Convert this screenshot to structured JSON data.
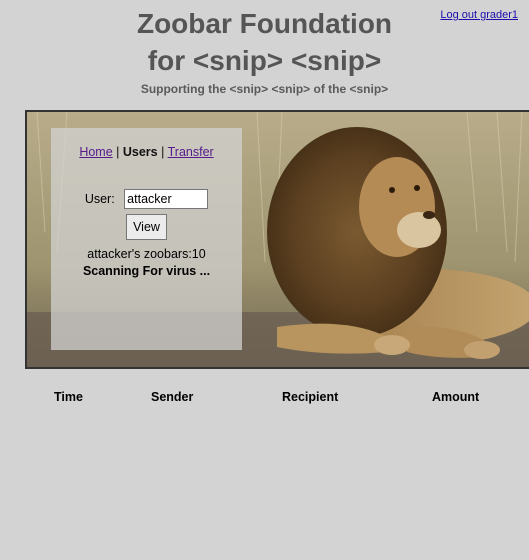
{
  "header": {
    "logout_link": "Log out grader1",
    "title_line1": "Zoobar Foundation",
    "title_line2": "for <snip> <snip>",
    "subtitle": "Supporting the <snip> <snip> of the <snip>"
  },
  "nav": {
    "home": "Home",
    "users": "Users",
    "transfer": "Transfer",
    "separator": "|"
  },
  "user_lookup": {
    "label": "User:",
    "value": "attacker",
    "view_button": "View",
    "zoobars_text": "attacker's zoobars:10",
    "status_text": "Scanning For virus ..."
  },
  "transfers_table": {
    "columns": [
      "Time",
      "Sender",
      "Recipient",
      "Amount"
    ]
  },
  "colors": {
    "page_bg": "#d3d3d3",
    "title": "#555555",
    "link_visited": "#551a8b",
    "link": "#1a0dab"
  }
}
